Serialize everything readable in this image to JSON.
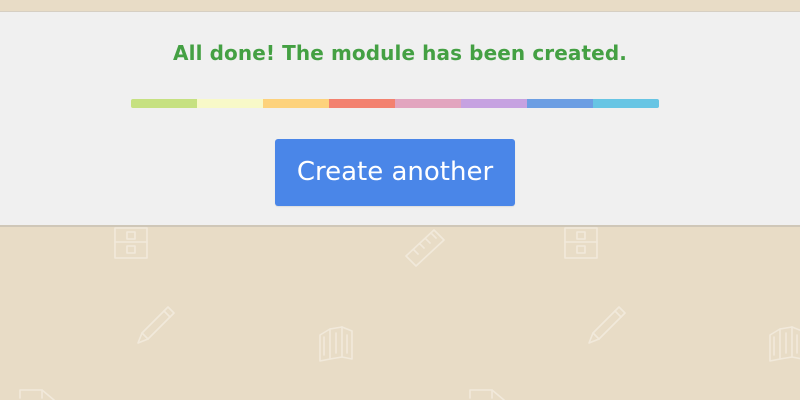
{
  "message": {
    "text": "All done! The module has been created.",
    "color": "#44a043"
  },
  "progress": {
    "fraction": 1.0,
    "segment_colors": [
      "#c6e181",
      "#f8f9c8",
      "#fdd27c",
      "#f3816f",
      "#e2a5bf",
      "#c6a2e1",
      "#6c9ee3",
      "#67c5e4"
    ]
  },
  "actions": {
    "create_another_label": "Create another",
    "button_color": "#4a86e8"
  },
  "background": {
    "color": "#e8dcc6",
    "icons": [
      "bookshelf-icon",
      "ruler-icon",
      "bookshelf-icon",
      "pencil-icon",
      "books-icon",
      "pencil-icon",
      "books-icon",
      "paper-icon",
      "paper-icon"
    ]
  }
}
